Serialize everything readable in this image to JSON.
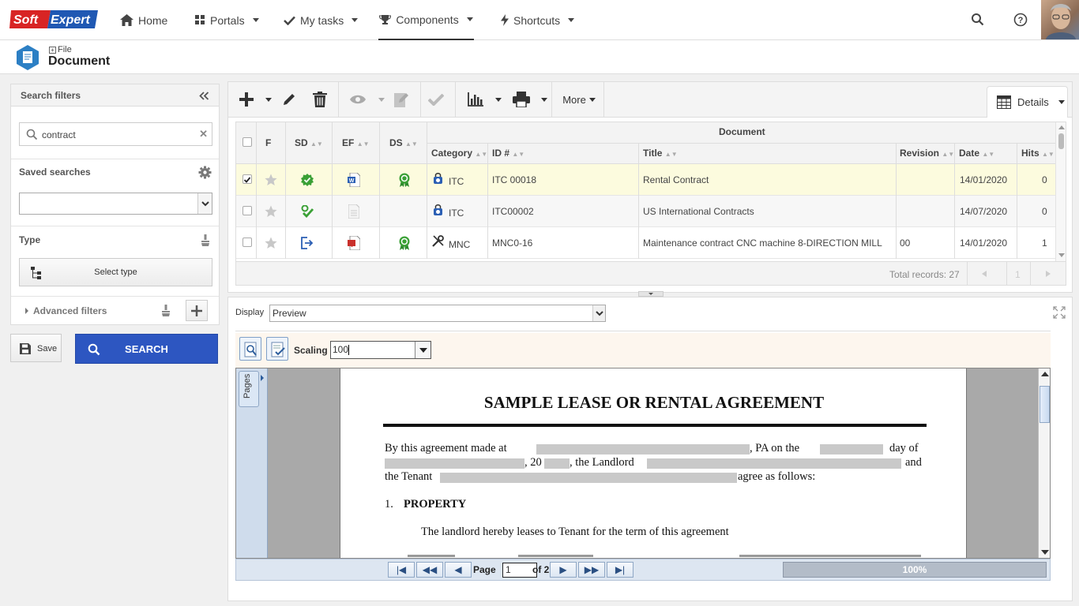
{
  "app": {
    "logo_text_1": "Soft",
    "logo_text_2": "Expert"
  },
  "nav": [
    {
      "label": "Home",
      "icon": "home-icon"
    },
    {
      "label": "Portals",
      "icon": "grid-icon"
    },
    {
      "label": "My tasks",
      "icon": "check-icon"
    },
    {
      "label": "Components",
      "icon": "trophy-icon"
    },
    {
      "label": "Shortcuts",
      "icon": "bolt-icon"
    }
  ],
  "header": {
    "crumb": "File",
    "title": "Document"
  },
  "filters": {
    "title": "Search filters",
    "search_value": "contract",
    "saved_searches_label": "Saved searches",
    "type_label": "Type",
    "select_type_label": "Select type",
    "advanced_label": "Advanced filters",
    "save_label": "Save",
    "search_label": "SEARCH"
  },
  "toolbar": {
    "more_label": "More",
    "details_label": "Details"
  },
  "grid": {
    "group_header": "Document",
    "columns": {
      "f": "F",
      "sd": "SD",
      "ef": "EF",
      "ds": "DS",
      "category": "Category",
      "id": "ID #",
      "title": "Title",
      "revision": "Revision",
      "date": "Date",
      "hits": "Hits"
    },
    "rows": [
      {
        "checked": true,
        "category": "ITC",
        "id": "ITC 00018",
        "title": "Rental Contract",
        "revision": "",
        "date": "14/01/2020",
        "hits": "0"
      },
      {
        "checked": false,
        "category": "ITC",
        "id": "ITC00002",
        "title": "US International Contracts",
        "revision": "",
        "date": "14/07/2020",
        "hits": "0"
      },
      {
        "checked": false,
        "category": "MNC",
        "id": "MNC0-16",
        "title": "Maintenance contract CNC machine 8-DIRECTION MILL",
        "revision": "00",
        "date": "14/01/2020",
        "hits": "1"
      }
    ],
    "total_records": "Total records: 27",
    "pager_page": "1"
  },
  "viewer": {
    "display_label": "Display",
    "display_value": "Preview",
    "scaling_label": "Scaling",
    "scaling_value": "100",
    "pages_tab": "Pages",
    "page_label": "Page",
    "page_value": "1",
    "page_of": "of 2",
    "zoom_progress": "100%"
  },
  "document": {
    "title": "SAMPLE LEASE OR RENTAL AGREEMENT",
    "line1_a": "By this agreement made at",
    "line1_b": ", PA on the",
    "line1_c": "day of",
    "line2_a": ", 20",
    "line2_b": ", the Landlord",
    "line2_c": "and",
    "line3_a": "the Tenant",
    "line3_b": "agree as follows:",
    "section1_num": "1.",
    "section1_title": "PROPERTY",
    "section1_text": "The landlord hereby leases to Tenant for the term of this agreement"
  },
  "colors": {
    "accent": "#2d56c1",
    "selected_row": "#fcfbde",
    "status_green": "#3aa035"
  }
}
